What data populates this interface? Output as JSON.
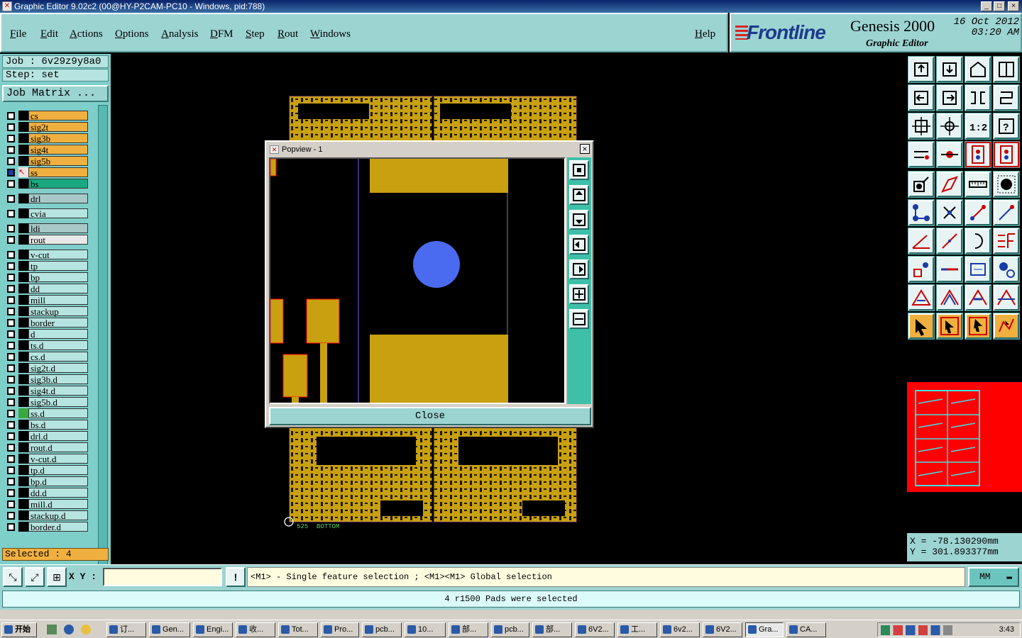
{
  "window": {
    "title": "Graphic Editor 9.02c2 (00@HY-P2CAM-PC10 - Windows, pid:788)"
  },
  "menu": [
    "File",
    "Edit",
    "Actions",
    "Options",
    "Analysis",
    "DFM",
    "Step",
    "Rout",
    "Windows"
  ],
  "help": "Help",
  "brand": {
    "logo": "Frontline",
    "product": "Genesis 2000",
    "subtitle": "Graphic Editor",
    "date": "16 Oct 2012",
    "time": "03:20 AM"
  },
  "job": {
    "job_line": "Job : 6v29z9y8a0",
    "step_line": "Step: set",
    "job_matrix": "Job Matrix ..."
  },
  "layers": [
    {
      "name": "cs",
      "color": "#f0b040"
    },
    {
      "name": "sig2t",
      "color": "#f0b040"
    },
    {
      "name": "sig3b",
      "color": "#f0b040"
    },
    {
      "name": "sig4t",
      "color": "#f0b040"
    },
    {
      "name": "sig5b",
      "color": "#f0b040"
    },
    {
      "name": "ss",
      "color": "#f0b040"
    },
    {
      "name": "bs",
      "color": "#1aa880"
    },
    {
      "name": "drl",
      "color": "#a8c8c8"
    },
    {
      "name": "cvia",
      "color": "#b6e4e0"
    },
    {
      "name": "ldi",
      "color": "#a8c8c8"
    },
    {
      "name": "rout",
      "color": "#e8e8e8"
    },
    {
      "name": "v-cut",
      "color": "#b6e4e0"
    },
    {
      "name": "tp",
      "color": "#b6e4e0"
    },
    {
      "name": "bp",
      "color": "#b6e4e0"
    },
    {
      "name": "dd",
      "color": "#b6e4e0"
    },
    {
      "name": "mill",
      "color": "#b6e4e0"
    },
    {
      "name": "stackup",
      "color": "#b6e4e0"
    },
    {
      "name": "border",
      "color": "#b6e4e0"
    },
    {
      "name": "d",
      "color": "#b6e4e0"
    },
    {
      "name": "ts.d",
      "color": "#b6e4e0"
    },
    {
      "name": "cs.d",
      "color": "#b6e4e0"
    },
    {
      "name": "sig2t.d",
      "color": "#b6e4e0"
    },
    {
      "name": "sig3b.d",
      "color": "#b6e4e0"
    },
    {
      "name": "sig4t.d",
      "color": "#b6e4e0"
    },
    {
      "name": "sig5b.d",
      "color": "#b6e4e0"
    },
    {
      "name": "ss.d",
      "color": "#b6e4e0"
    },
    {
      "name": "bs.d",
      "color": "#b6e4e0"
    },
    {
      "name": "drl.d",
      "color": "#b6e4e0"
    },
    {
      "name": "rout.d",
      "color": "#b6e4e0"
    },
    {
      "name": "v-cut.d",
      "color": "#b6e4e0"
    },
    {
      "name": "tp.d",
      "color": "#b6e4e0"
    },
    {
      "name": "bp.d",
      "color": "#b6e4e0"
    },
    {
      "name": "dd.d",
      "color": "#b6e4e0"
    },
    {
      "name": "mill.d",
      "color": "#b6e4e0"
    },
    {
      "name": "stackup.d",
      "color": "#b6e4e0"
    },
    {
      "name": "border.d",
      "color": "#b6e4e0"
    }
  ],
  "selected": "Selected : 4",
  "popview": {
    "title": "Popview - 1",
    "close_label": "Close"
  },
  "canvas": {
    "label": "BOTTOM",
    "label_num": "525"
  },
  "coords": {
    "x": "X = -78.130290mm",
    "y": "Y = 301.893377mm"
  },
  "bottombar": {
    "xy_label": "X Y :",
    "xy_value": "",
    "hint": "<M1> - Single feature selection ; <M1><M1> Global selection",
    "units": "MM"
  },
  "status": "4 r1500 Pads were selected",
  "taskbar": {
    "start": "开始",
    "tasks": [
      "订...",
      "Gen...",
      "Engi...",
      "收...",
      "Tot...",
      "Pro...",
      "pcb...",
      "10...",
      "部...",
      "pcb...",
      "部...",
      "6V2...",
      "工...",
      "6v2...",
      "6V2...",
      "Gra...",
      "CA..."
    ],
    "clock": "3:43"
  },
  "colors": {
    "copper": "#c8a010",
    "bg": "#000000",
    "panel": "#9cd4d2",
    "pad": "#4a6af0"
  }
}
